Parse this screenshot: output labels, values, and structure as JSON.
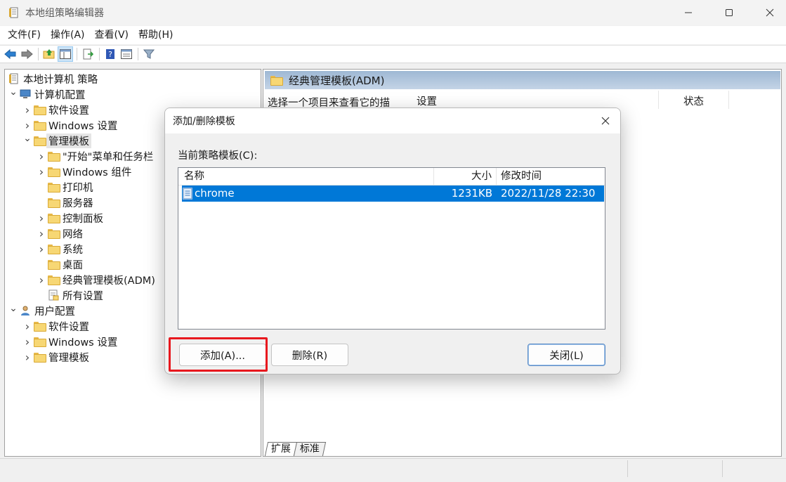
{
  "window": {
    "title": "本地组策略编辑器",
    "minimize_label": "—",
    "maximize_label": "☐",
    "close_label": "✕"
  },
  "menu": [
    "文件(F)",
    "操作(A)",
    "查看(V)",
    "帮助(H)"
  ],
  "toolbar_icons": [
    "back-arrow-icon",
    "forward-arrow-icon",
    "up-folder-icon",
    "show-hide-tree-icon",
    "export-list-icon",
    "help-icon",
    "properties-icon",
    "filter-icon"
  ],
  "tree": [
    {
      "label": "本地计算机 策略",
      "level": 0,
      "chevron": "",
      "icon": "policy-doc-icon"
    },
    {
      "label": "计算机配置",
      "level": 0,
      "chevron": "⌄",
      "icon": "computer-icon"
    },
    {
      "label": "软件设置",
      "level": 1,
      "chevron": "›",
      "icon": "folder-icon"
    },
    {
      "label": "Windows 设置",
      "level": 1,
      "chevron": "›",
      "icon": "folder-icon"
    },
    {
      "label": "管理模板",
      "level": 1,
      "chevron": "⌄",
      "icon": "folder-icon",
      "selected": true
    },
    {
      "label": "\"开始\"菜单和任务栏",
      "level": 2,
      "chevron": "›",
      "icon": "folder-icon"
    },
    {
      "label": "Windows 组件",
      "level": 2,
      "chevron": "›",
      "icon": "folder-icon"
    },
    {
      "label": "打印机",
      "level": 2,
      "chevron": "",
      "icon": "folder-icon"
    },
    {
      "label": "服务器",
      "level": 2,
      "chevron": "",
      "icon": "folder-icon"
    },
    {
      "label": "控制面板",
      "level": 2,
      "chevron": "›",
      "icon": "folder-icon"
    },
    {
      "label": "网络",
      "level": 2,
      "chevron": "›",
      "icon": "folder-icon"
    },
    {
      "label": "系统",
      "level": 2,
      "chevron": "›",
      "icon": "folder-icon"
    },
    {
      "label": "桌面",
      "level": 2,
      "chevron": "",
      "icon": "folder-icon"
    },
    {
      "label": "经典管理模板(ADM)",
      "level": 2,
      "chevron": "›",
      "icon": "folder-icon"
    },
    {
      "label": "所有设置",
      "level": 2,
      "chevron": "",
      "icon": "all-settings-icon"
    },
    {
      "label": "用户配置",
      "level": 0,
      "chevron": "⌄",
      "icon": "user-icon"
    },
    {
      "label": "软件设置",
      "level": 1,
      "chevron": "›",
      "icon": "folder-icon"
    },
    {
      "label": "Windows 设置",
      "level": 1,
      "chevron": "›",
      "icon": "folder-icon"
    },
    {
      "label": "管理模板",
      "level": 1,
      "chevron": "›",
      "icon": "folder-icon"
    }
  ],
  "right_pane": {
    "header": "经典管理模板(ADM)",
    "description": "选择一个项目来查看它的描",
    "col_setting": "设置",
    "col_status": "状态",
    "tab_extended": "扩展",
    "tab_standard": "标准"
  },
  "dialog": {
    "title": "添加/删除模板",
    "close_label": "✕",
    "current_label": "当前策略模板(C):",
    "columns": {
      "name": "名称",
      "size": "大小",
      "modified": "修改时间"
    },
    "rows": [
      {
        "name": "chrome",
        "size": "1231KB",
        "modified": "2022/11/28 22:30"
      }
    ],
    "add_button": "添加(A)...",
    "remove_button": "删除(R)",
    "close_button": "关闭(L)"
  },
  "colors": {
    "selection": "#0078d7",
    "highlight_box": "#e8181e",
    "folder": "#f7d774"
  }
}
